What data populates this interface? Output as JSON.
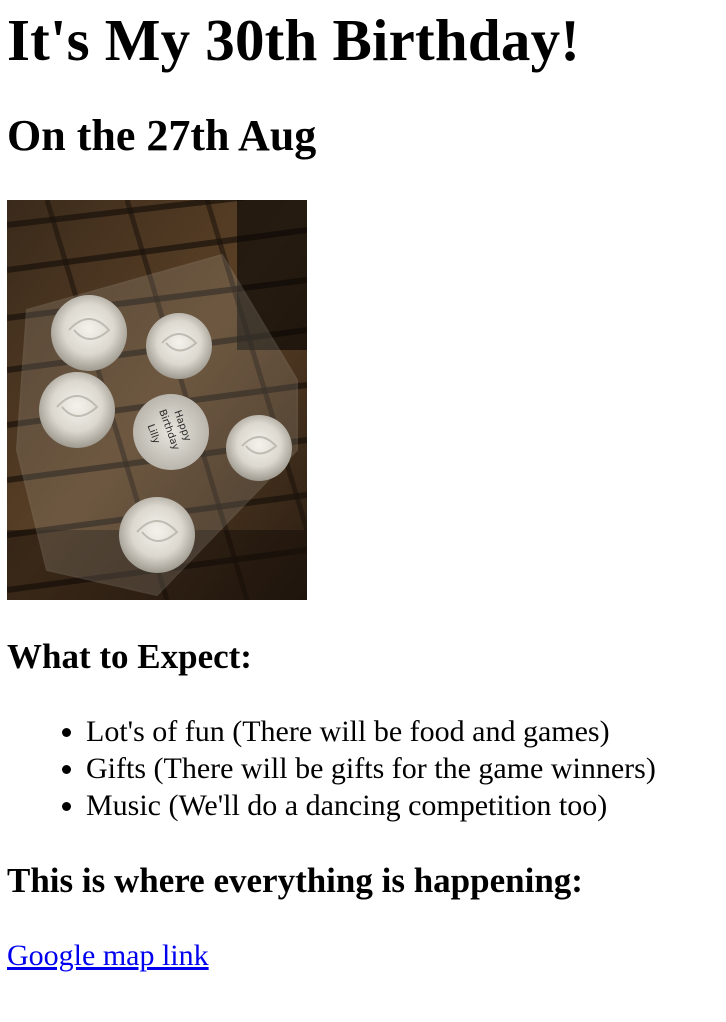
{
  "page": {
    "title": "It's My 30th Birthday!",
    "subtitle": "On the 27th Aug"
  },
  "photo": {
    "cake_text": [
      "Happy",
      "Birthday",
      "Lilly"
    ]
  },
  "expect": {
    "heading": "What to Expect:",
    "items": [
      "Lot's of fun (There will be food and games)",
      "Gifts (There will be gifts for the game winners)",
      "Music (We'll do a dancing competition too)"
    ]
  },
  "location": {
    "heading": "This is where everything is happening:",
    "link_text": "Google map link"
  },
  "colors": {
    "link": "#0000ee",
    "text": "#000000",
    "background": "#ffffff"
  }
}
